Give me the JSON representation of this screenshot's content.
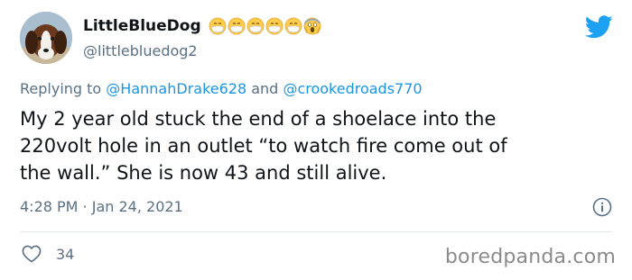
{
  "tweet": {
    "display_name": "LittleBlueDog",
    "emojis": [
      "face-with-medical-mask",
      "face-with-medical-mask",
      "face-with-medical-mask",
      "face-with-medical-mask",
      "face-with-medical-mask",
      "face-screaming-in-fear"
    ],
    "handle": "@littlebluedog2",
    "replying_prefix": "Replying to",
    "replying_to": [
      "@HannahDrake628",
      "@crookedroads770"
    ],
    "replying_and": "and",
    "text_lines": [
      "My 2 year old stuck the end of a shoelace into the",
      "220volt hole in an outlet “to watch fire come out of",
      "the wall.” She is now 43 and still alive."
    ],
    "timestamp": "4:28 PM · Jan 24, 2021",
    "likes": "34"
  },
  "watermark": "boredpanda.com",
  "icons": {
    "brand": "twitter-bird-icon",
    "info": "info-icon",
    "like": "heart-icon"
  },
  "colors": {
    "twitter_blue": "#1da1f2",
    "mention_blue": "#1b95e0",
    "secondary_text": "#5b7083",
    "primary_text": "#0f1419"
  }
}
